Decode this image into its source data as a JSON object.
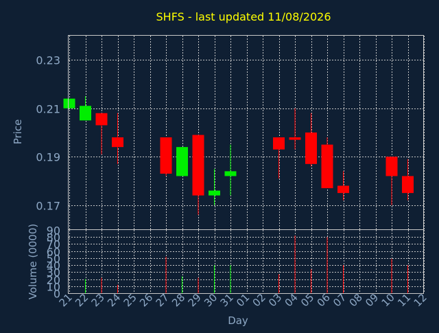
{
  "chart_data": [
    {
      "type": "candlestick",
      "title": "SHFS - last updated 11/08/2026",
      "ylabel": "Price",
      "ylim": [
        0.16,
        0.24
      ],
      "yticks": [
        0.17,
        0.19,
        0.21,
        0.23
      ],
      "grid": true,
      "x": [
        "21",
        "22",
        "23",
        "24",
        "25",
        "26",
        "27",
        "28",
        "29",
        "30",
        "31",
        "01",
        "02",
        "03",
        "04",
        "05",
        "06",
        "07",
        "08",
        "09",
        "10",
        "11",
        "12"
      ],
      "series": [
        {
          "values": [
            {
              "x": "21",
              "open": 0.21,
              "high": 0.214,
              "low": 0.21,
              "close": 0.214
            },
            {
              "x": "22",
              "open": 0.205,
              "high": 0.215,
              "low": 0.205,
              "close": 0.211
            },
            {
              "x": "23",
              "open": 0.208,
              "high": 0.208,
              "low": 0.191,
              "close": 0.203
            },
            {
              "x": "24",
              "open": 0.198,
              "high": 0.208,
              "low": 0.187,
              "close": 0.194
            },
            {
              "x": "27",
              "open": 0.198,
              "high": 0.198,
              "low": 0.182,
              "close": 0.183
            },
            {
              "x": "28",
              "open": 0.182,
              "high": 0.194,
              "low": 0.182,
              "close": 0.194
            },
            {
              "x": "29",
              "open": 0.199,
              "high": 0.199,
              "low": 0.166,
              "close": 0.174
            },
            {
              "x": "30",
              "open": 0.174,
              "high": 0.185,
              "low": 0.17,
              "close": 0.176
            },
            {
              "x": "31",
              "open": 0.182,
              "high": 0.195,
              "low": 0.174,
              "close": 0.184
            },
            {
              "x": "03",
              "open": 0.198,
              "high": 0.198,
              "low": 0.181,
              "close": 0.193
            },
            {
              "x": "04",
              "open": 0.198,
              "high": 0.21,
              "low": 0.193,
              "close": 0.197
            },
            {
              "x": "05",
              "open": 0.2,
              "high": 0.208,
              "low": 0.186,
              "close": 0.187
            },
            {
              "x": "06",
              "open": 0.195,
              "high": 0.198,
              "low": 0.177,
              "close": 0.177
            },
            {
              "x": "07",
              "open": 0.178,
              "high": 0.184,
              "low": 0.172,
              "close": 0.175
            },
            {
              "x": "10",
              "open": 0.19,
              "high": 0.19,
              "low": 0.17,
              "close": 0.182
            },
            {
              "x": "11",
              "open": 0.182,
              "high": 0.189,
              "low": 0.172,
              "close": 0.175
            }
          ]
        }
      ]
    },
    {
      "type": "bar",
      "xlabel": "Day",
      "ylabel": "Volume (0000)",
      "ylim": [
        0,
        90
      ],
      "yticks": [
        0,
        10,
        20,
        30,
        40,
        50,
        60,
        70,
        80,
        90
      ],
      "x": [
        "21",
        "22",
        "23",
        "24",
        "25",
        "26",
        "27",
        "28",
        "29",
        "30",
        "31",
        "01",
        "02",
        "03",
        "04",
        "05",
        "06",
        "07",
        "08",
        "09",
        "10",
        "11",
        "12"
      ],
      "series": [
        {
          "values": [
            {
              "x": "22",
              "value": 20,
              "dir": "up"
            },
            {
              "x": "23",
              "value": 22,
              "dir": "down"
            },
            {
              "x": "24",
              "value": 12,
              "dir": "down"
            },
            {
              "x": "27",
              "value": 52,
              "dir": "down"
            },
            {
              "x": "28",
              "value": 24,
              "dir": "up"
            },
            {
              "x": "29",
              "value": 22,
              "dir": "down"
            },
            {
              "x": "30",
              "value": 40,
              "dir": "up"
            },
            {
              "x": "31",
              "value": 40,
              "dir": "up"
            },
            {
              "x": "03",
              "value": 27,
              "dir": "down"
            },
            {
              "x": "04",
              "value": 82,
              "dir": "down"
            },
            {
              "x": "05",
              "value": 34,
              "dir": "down"
            },
            {
              "x": "06",
              "value": 80,
              "dir": "down"
            },
            {
              "x": "07",
              "value": 40,
              "dir": "down"
            },
            {
              "x": "10",
              "value": 49,
              "dir": "down"
            },
            {
              "x": "11",
              "value": 40,
              "dir": "down"
            }
          ]
        }
      ]
    }
  ],
  "colors": {
    "background": "#0f1f33",
    "plot_border": "#c8c8c8",
    "grid": "#c8c8c8",
    "axis_text": "#8fa9c6",
    "title": "#ffff00",
    "up": "#00ee00",
    "down": "#ff0000"
  }
}
